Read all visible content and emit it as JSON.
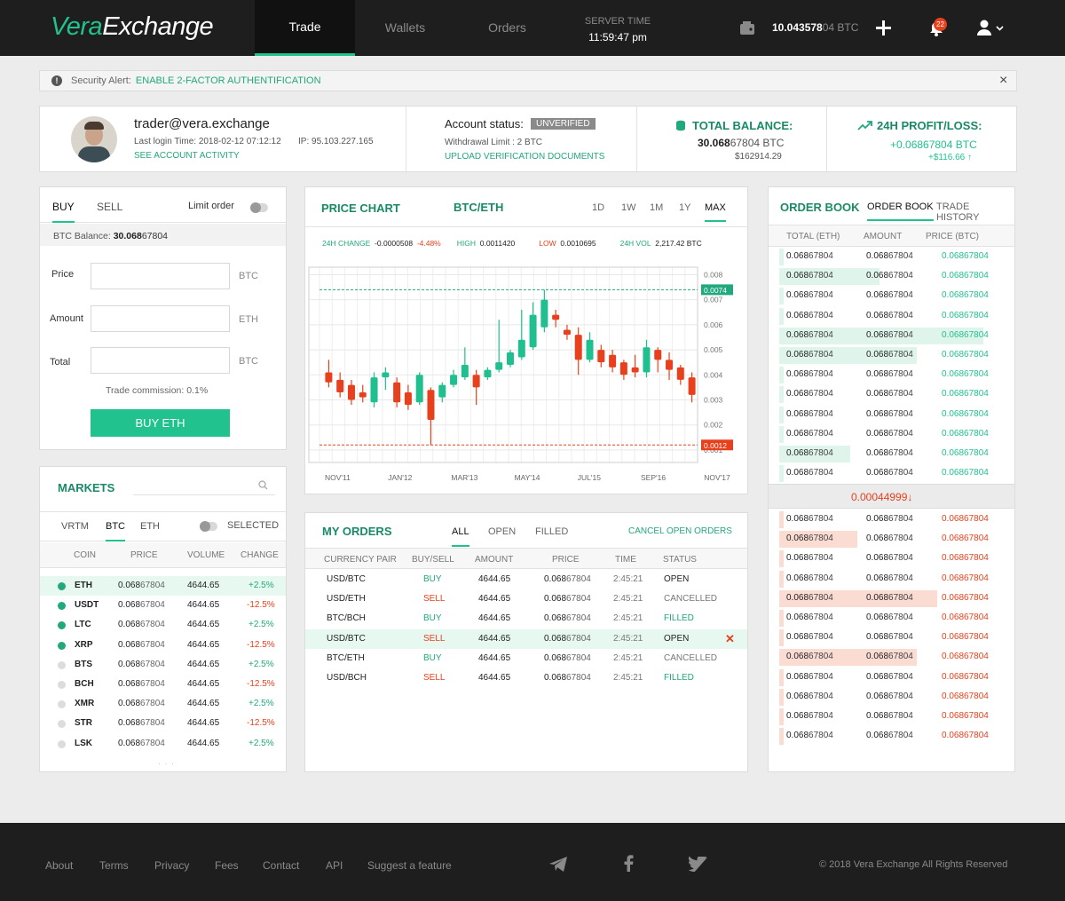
{
  "app": {
    "logo_part1": "Vera",
    "logo_part2": "Exchange"
  },
  "nav": {
    "tabs": [
      {
        "label": "Trade"
      },
      {
        "label": "Wallets"
      },
      {
        "label": "Orders"
      }
    ],
    "server_time_label": "SERVER TIME",
    "server_time": "11:59:47 pm",
    "balance_main": "10.043578",
    "balance_dim": "04 BTC",
    "notifications_count": "22"
  },
  "alert": {
    "prefix": "Security Alert:",
    "link": "ENABLE 2-FACTOR AUTHENTIFICATION"
  },
  "account": {
    "email": "trader@vera.exchange",
    "last_login": "Last login Time: 2018-02-12 07:12:12",
    "ip": "IP: 95.103.227.165",
    "activity_link": "SEE ACCOUNT ACTIVITY",
    "status_label": "Account status:",
    "status_badge": "UNVERIFIED",
    "withdraw_limit": "Withdrawal Limit :  2 BTC",
    "upload_link": "UPLOAD VERIFICATION DOCUMENTS",
    "total_balance_label": "TOTAL BALANCE:",
    "total_balance_main": "30.068",
    "total_balance_dim": "67804 BTC",
    "total_balance_usd": "$162914.29",
    "profit_label": "24H PROFIT/LOSS:",
    "profit_value": "+0.06867804 BTC",
    "profit_usd": "+$116.66 ↑"
  },
  "trade": {
    "tab_buy": "BUY",
    "tab_sell": "SELL",
    "limit_label": "Limit order",
    "balance_label": "BTC Balance:",
    "balance_main": "30.068",
    "balance_dim": "67804",
    "fields": [
      {
        "label": "Price",
        "unit": "BTC"
      },
      {
        "label": "Amount",
        "unit": "ETH"
      },
      {
        "label": "Total",
        "unit": "BTC"
      }
    ],
    "commission": "Trade commission: 0.1%",
    "buy_button": "BUY ETH"
  },
  "markets": {
    "title": "MARKETS",
    "tabs": [
      "VRTM",
      "BTC",
      "ETH"
    ],
    "selected_label": "SELECTED",
    "columns": [
      "COIN",
      "PRICE",
      "VOLUME",
      "CHANGE"
    ],
    "rows": [
      {
        "coin": "ETH",
        "price_main": "0.068",
        "price_dim": "67804",
        "volume": "4644.65",
        "change": "+2.5%",
        "dot": "#21a87c",
        "highlight": true
      },
      {
        "coin": "USDT",
        "price_main": "0.068",
        "price_dim": "67804",
        "volume": "4644.65",
        "change": "-12.5%",
        "dot": "#21a87c",
        "highlight": false
      },
      {
        "coin": "LTC",
        "price_main": "0.068",
        "price_dim": "67804",
        "volume": "4644.65",
        "change": "+2.5%",
        "dot": "#21a87c",
        "highlight": false
      },
      {
        "coin": "XRP",
        "price_main": "0.068",
        "price_dim": "67804",
        "volume": "4644.65",
        "change": "-12.5%",
        "dot": "#21a87c",
        "highlight": false
      },
      {
        "coin": "BTS",
        "price_main": "0.068",
        "price_dim": "67804",
        "volume": "4644.65",
        "change": "+2.5%",
        "dot": "#dcdcdc",
        "highlight": false
      },
      {
        "coin": "BCH",
        "price_main": "0.068",
        "price_dim": "67804",
        "volume": "4644.65",
        "change": "-12.5%",
        "dot": "#dcdcdc",
        "highlight": false
      },
      {
        "coin": "XMR",
        "price_main": "0.068",
        "price_dim": "67804",
        "volume": "4644.65",
        "change": "+2.5%",
        "dot": "#dcdcdc",
        "highlight": false
      },
      {
        "coin": "STR",
        "price_main": "0.068",
        "price_dim": "67804",
        "volume": "4644.65",
        "change": "-12.5%",
        "dot": "#dcdcdc",
        "highlight": false
      },
      {
        "coin": "LSK",
        "price_main": "0.068",
        "price_dim": "67804",
        "volume": "4644.65",
        "change": "+2.5%",
        "dot": "#dcdcdc",
        "highlight": false
      }
    ],
    "more": "· · ·"
  },
  "chart": {
    "title": "PRICE CHART",
    "pair": "BTC/ETH",
    "ranges": [
      "1D",
      "1W",
      "1M",
      "1Y",
      "MAX"
    ],
    "active_range": "MAX",
    "stats": {
      "change_label": "24H CHANGE",
      "change_value": "-0.0000508",
      "change_pct": "-4.48%",
      "high_label": "HIGH",
      "high_value": "0.0011420",
      "low_label": "LOW",
      "low_value": "0.0010695",
      "vol_label": "24H VOL",
      "vol_value": "2,217.42 BTC"
    },
    "y_ticks": [
      "0.008",
      "0.007",
      "0.006",
      "0.005",
      "0.004",
      "0.003",
      "0.002",
      "0.001"
    ],
    "marker_high": "0.0074",
    "marker_low": "0.0012",
    "x_ticks": [
      "NOV'11",
      "JAN'12",
      "MAR'13",
      "MAY'14",
      "JUL'15",
      "SEP'16",
      "NOV'17"
    ]
  },
  "chart_data": {
    "type": "candlestick",
    "ylim": [
      0.0005,
      0.0083
    ],
    "y_ticks": [
      0.008,
      0.007,
      0.006,
      0.005,
      0.004,
      0.003,
      0.002,
      0.001
    ],
    "x_labels": [
      "NOV'11",
      "JAN'12",
      "MAR'13",
      "MAY'14",
      "JUL'15",
      "SEP'16",
      "NOV'17"
    ],
    "candles": [
      {
        "o": 0.0041,
        "h": 0.0046,
        "l": 0.0035,
        "c": 0.0037
      },
      {
        "o": 0.0038,
        "h": 0.0041,
        "l": 0.0031,
        "c": 0.0033
      },
      {
        "o": 0.0036,
        "h": 0.0038,
        "l": 0.0028,
        "c": 0.003
      },
      {
        "o": 0.0033,
        "h": 0.0036,
        "l": 0.0029,
        "c": 0.0031
      },
      {
        "o": 0.0029,
        "h": 0.0041,
        "l": 0.0027,
        "c": 0.0039
      },
      {
        "o": 0.0039,
        "h": 0.0043,
        "l": 0.0034,
        "c": 0.0041
      },
      {
        "o": 0.0037,
        "h": 0.0039,
        "l": 0.0027,
        "c": 0.0029
      },
      {
        "o": 0.0033,
        "h": 0.0036,
        "l": 0.0026,
        "c": 0.0028
      },
      {
        "o": 0.0029,
        "h": 0.0041,
        "l": 0.0028,
        "c": 0.004
      },
      {
        "o": 0.0034,
        "h": 0.0035,
        "l": 0.0012,
        "c": 0.0022
      },
      {
        "o": 0.0031,
        "h": 0.0037,
        "l": 0.0029,
        "c": 0.0036
      },
      {
        "o": 0.0036,
        "h": 0.0042,
        "l": 0.0035,
        "c": 0.004
      },
      {
        "o": 0.0039,
        "h": 0.0051,
        "l": 0.0038,
        "c": 0.0044
      },
      {
        "o": 0.004,
        "h": 0.0042,
        "l": 0.0028,
        "c": 0.0035
      },
      {
        "o": 0.0039,
        "h": 0.0043,
        "l": 0.0038,
        "c": 0.0042
      },
      {
        "o": 0.0042,
        "h": 0.0062,
        "l": 0.0041,
        "c": 0.0045
      },
      {
        "o": 0.0044,
        "h": 0.005,
        "l": 0.0043,
        "c": 0.0049
      },
      {
        "o": 0.0047,
        "h": 0.0066,
        "l": 0.0046,
        "c": 0.0054
      },
      {
        "o": 0.0051,
        "h": 0.0069,
        "l": 0.005,
        "c": 0.0064
      },
      {
        "o": 0.0059,
        "h": 0.0074,
        "l": 0.0057,
        "c": 0.007
      },
      {
        "o": 0.0064,
        "h": 0.0066,
        "l": 0.0059,
        "c": 0.0062
      },
      {
        "o": 0.0058,
        "h": 0.006,
        "l": 0.0054,
        "c": 0.0056
      },
      {
        "o": 0.0056,
        "h": 0.0059,
        "l": 0.004,
        "c": 0.0046
      },
      {
        "o": 0.0046,
        "h": 0.0057,
        "l": 0.0045,
        "c": 0.0054
      },
      {
        "o": 0.005,
        "h": 0.0052,
        "l": 0.0043,
        "c": 0.0045
      },
      {
        "o": 0.0048,
        "h": 0.005,
        "l": 0.0041,
        "c": 0.0043
      },
      {
        "o": 0.0045,
        "h": 0.0046,
        "l": 0.0038,
        "c": 0.004
      },
      {
        "o": 0.0043,
        "h": 0.0048,
        "l": 0.0039,
        "c": 0.0041
      },
      {
        "o": 0.0041,
        "h": 0.0054,
        "l": 0.0039,
        "c": 0.0051
      },
      {
        "o": 0.005,
        "h": 0.0051,
        "l": 0.0041,
        "c": 0.0046
      },
      {
        "o": 0.0046,
        "h": 0.0049,
        "l": 0.0038,
        "c": 0.0042
      },
      {
        "o": 0.0043,
        "h": 0.0044,
        "l": 0.0036,
        "c": 0.0038
      },
      {
        "o": 0.0039,
        "h": 0.0041,
        "l": 0.0029,
        "c": 0.0032
      }
    ]
  },
  "orders": {
    "title": "MY ORDERS",
    "tabs": [
      "ALL",
      "OPEN",
      "FILLED"
    ],
    "cancel_link": "CANCEL OPEN ORDERS",
    "columns": [
      "CURRENCY PAIR",
      "BUY/SELL",
      "AMOUNT",
      "PRICE",
      "TIME",
      "STATUS"
    ],
    "rows": [
      {
        "pair": "USD/BTC",
        "side": "BUY",
        "amount": "4644.65",
        "price_main": "0.068",
        "price_dim": "67804",
        "time": "2:45:21",
        "status": "OPEN",
        "highlight": false,
        "cancel": ""
      },
      {
        "pair": "USD/ETH",
        "side": "SELL",
        "amount": "4644.65",
        "price_main": "0.068",
        "price_dim": "67804",
        "time": "2:45:21",
        "status": "CANCELLED",
        "highlight": false,
        "cancel": ""
      },
      {
        "pair": "BTC/BCH",
        "side": "BUY",
        "amount": "4644.65",
        "price_main": "0.068",
        "price_dim": "67804",
        "time": "2:45:21",
        "status": "FILLED",
        "highlight": false,
        "cancel": ""
      },
      {
        "pair": "USD/BTC",
        "side": "SELL",
        "amount": "4644.65",
        "price_main": "0.068",
        "price_dim": "67804",
        "time": "2:45:21",
        "status": "OPEN",
        "highlight": true,
        "cancel": "✕"
      },
      {
        "pair": "BTC/ETH",
        "side": "BUY",
        "amount": "4644.65",
        "price_main": "0.068",
        "price_dim": "67804",
        "time": "2:45:21",
        "status": "CANCELLED",
        "highlight": false,
        "cancel": ""
      },
      {
        "pair": "USD/BCH",
        "side": "SELL",
        "amount": "4644.65",
        "price_main": "0.068",
        "price_dim": "67804",
        "time": "2:45:21",
        "status": "FILLED",
        "highlight": false,
        "cancel": ""
      }
    ]
  },
  "orderbook": {
    "title": "ORDER BOOK",
    "tabs": [
      "ORDER BOOK",
      "TRADE HISTORY"
    ],
    "columns": [
      "TOTAL (ETH)",
      "AMOUNT",
      "PRICE  (BTC)"
    ],
    "num_main": "0.068",
    "num_dim": "67804",
    "mid_price": "0.00044999↓",
    "bids": [
      0.02,
      0.45,
      0.02,
      0.02,
      0.92,
      0.62,
      0.02,
      0.02,
      0.02,
      0.02,
      0.32,
      0.02
    ],
    "asks": [
      0.02,
      0.35,
      0.02,
      0.02,
      0.71,
      0.02,
      0.02,
      0.62,
      0.02,
      0.02,
      0.02,
      0.02
    ]
  },
  "footer": {
    "links": [
      "About",
      "Terms",
      "Privacy",
      "Fees",
      "Contact",
      "API",
      "Suggest a feature"
    ],
    "copyright": "© 2018 Vera Exchange   All Rights Reserved"
  }
}
